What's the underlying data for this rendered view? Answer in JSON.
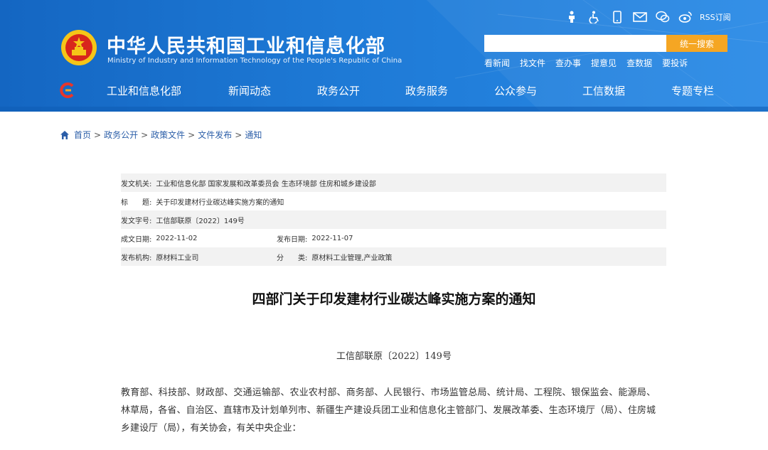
{
  "header": {
    "title": "中华人民共和国工业和信息化部",
    "subtitle": "Ministry of Industry and Information Technology of the People's Republic of China",
    "rss_label": "RSS订阅",
    "search": {
      "placeholder": "",
      "button_label": "统一搜索"
    },
    "quick_links": [
      "看新闻",
      "找文件",
      "查办事",
      "提意见",
      "查数据",
      "要投诉"
    ],
    "top_icons": [
      "elder-mode-icon",
      "accessibility-icon",
      "mobile-icon",
      "mail-icon",
      "wechat-icon",
      "weibo-icon"
    ],
    "colors": {
      "header_blue": "#1466c2",
      "search_button": "#f5a623"
    }
  },
  "nav": {
    "items": [
      "工业和信息化部",
      "新闻动态",
      "政务公开",
      "政务服务",
      "公众参与",
      "工信数据",
      "专题专栏"
    ]
  },
  "breadcrumb": {
    "items": [
      "首页",
      "政务公开",
      "政策文件",
      "文件发布",
      "通知"
    ],
    "separator": ">"
  },
  "meta": {
    "issuer_label": "发文机关:",
    "issuer": "工业和信息化部 国家发展和改革委员会 生态环境部 住房和城乡建设部",
    "title_label": "标　　题:",
    "title": "关于印发建材行业碳达峰实施方案的通知",
    "doc_no_label": "发文字号:",
    "doc_no": "工信部联原〔2022〕149号",
    "created_label": "成文日期:",
    "created": "2022-11-02",
    "published_label": "发布日期:",
    "published": "2022-11-07",
    "org_label": "发布机构:",
    "org": "原材料工业司",
    "category_label": "分　　类:",
    "category": "原材料工业管理,产业政策"
  },
  "article": {
    "title": "四部门关于印发建材行业碳达峰实施方案的通知",
    "doc_no": "工信部联原〔2022〕149号",
    "body": "教育部、科技部、财政部、交通运输部、农业农村部、商务部、人民银行、市场监管总局、统计局、工程院、银保监会、能源局、林草局，各省、自治区、直辖市及计划单列市、新疆生产建设兵团工业和信息化主管部门、发展改革委、生态环境厅（局）、住房城乡建设厅（局），有关协会，有关中央企业："
  }
}
